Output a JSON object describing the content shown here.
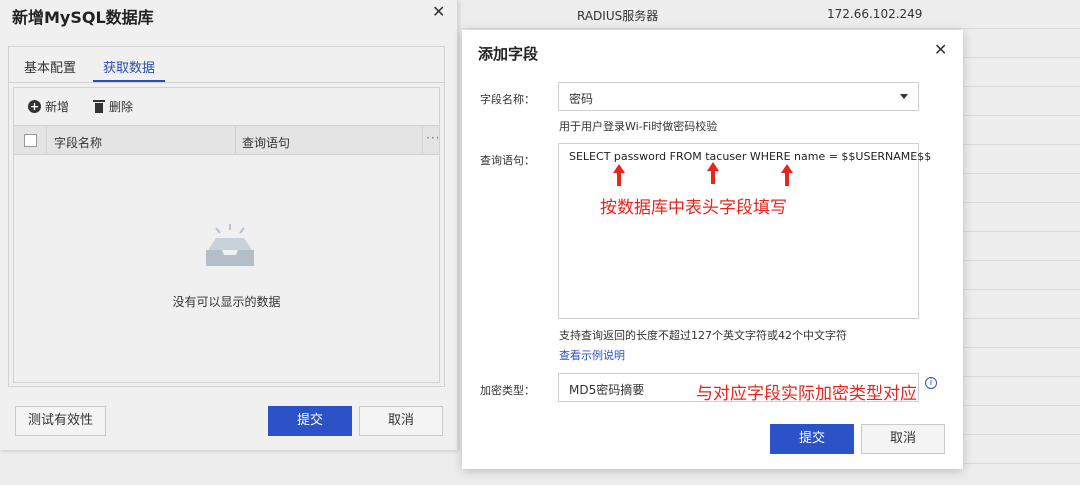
{
  "background": {
    "rows": [
      {
        "type": "RADIUS服务器",
        "ip": "172.66.102.249"
      }
    ]
  },
  "left_dialog": {
    "title": "新增MySQL数据库",
    "tabs": [
      {
        "label": "基本配置",
        "active": false
      },
      {
        "label": "获取数据",
        "active": true
      }
    ],
    "toolbar": {
      "add_label": "新增",
      "delete_label": "删除"
    },
    "columns": [
      "字段名称",
      "查询语句"
    ],
    "empty_text": "没有可以显示的数据",
    "test_label": "测试有效性",
    "submit_label": "提交",
    "cancel_label": "取消"
  },
  "right_dialog": {
    "title": "添加字段",
    "field_name_label": "字段名称：",
    "field_name_value": "密码",
    "field_hint": "用于用户登录Wi-Fi时做密码校验",
    "query_label": "查询语句：",
    "query_value": "SELECT password FROM tacuser WHERE name = $$USERNAME$$",
    "query_hint": "支持查询返回的长度不超过127个英文字符或42个中文字符",
    "example_link": "查看示例说明",
    "encrypt_label": "加密类型：",
    "encrypt_value": "MD5密码摘要",
    "submit_label": "提交",
    "cancel_label": "取消"
  },
  "annotations": {
    "query_note": "按数据库中表头字段填写",
    "encrypt_note": "与对应字段实际加密类型对应"
  },
  "colors": {
    "primary": "#2b52c7",
    "annotation": "#e8251c"
  }
}
